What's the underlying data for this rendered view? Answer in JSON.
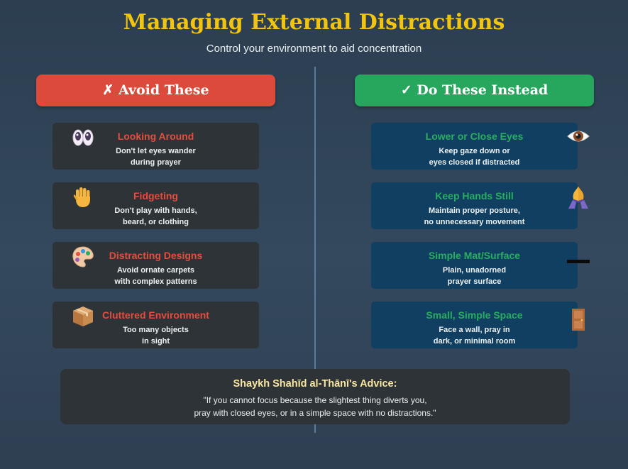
{
  "title": "Managing External Distractions",
  "subtitle": "Control your environment to aid concentration",
  "avoid": {
    "header": "✗ Avoid These",
    "color": "#dc4a3c",
    "items": [
      {
        "icon": "eyes-icon",
        "title": "Looking Around",
        "line1": "Don't let eyes wander",
        "line2": "during prayer"
      },
      {
        "icon": "raised-hand-icon",
        "title": "Fidgeting",
        "line1": "Don't play with hands,",
        "line2": "beard, or clothing"
      },
      {
        "icon": "palette-icon",
        "title": "Distracting Designs",
        "line1": "Avoid ornate carpets",
        "line2": "with complex patterns"
      },
      {
        "icon": "package-icon",
        "title": "Cluttered Environment",
        "line1": "Too many objects",
        "line2": "in sight"
      }
    ]
  },
  "do": {
    "header": "✓ Do These Instead",
    "color": "#27a65d",
    "items": [
      {
        "icon": "eye-icon",
        "title": "Lower or Close Eyes",
        "line1": "Keep gaze down or",
        "line2": "eyes closed if distracted"
      },
      {
        "icon": "praying-hands-icon",
        "title": "Keep Hands Still",
        "line1": "Maintain proper posture,",
        "line2": "no unnecessary movement"
      },
      {
        "icon": "dash-icon",
        "title": "Simple Mat/Surface",
        "line1": "Plain, unadorned",
        "line2": "prayer surface"
      },
      {
        "icon": "door-icon",
        "title": "Small, Simple Space",
        "line1": "Face a wall, pray in",
        "line2": "dark, or minimal room"
      }
    ]
  },
  "advice": {
    "title": "Shaykh Shahīd al-Thānī's Advice:",
    "line1": "\"If you cannot focus because the slightest thing diverts you,",
    "line2": "pray with closed eyes, or in a simple space with no distractions.\""
  }
}
